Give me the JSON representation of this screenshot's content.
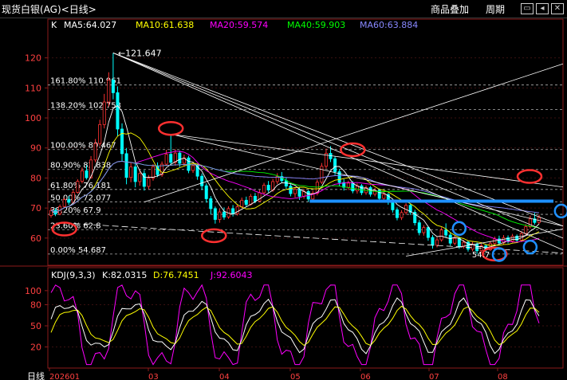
{
  "header": {
    "title": "现货白银(AG)<日线>",
    "overlay_button": "商品叠加",
    "period_button": "周期",
    "icons": [
      "restore-window-icon",
      "arrow-left-icon",
      "close-icon"
    ]
  },
  "main_panel": {
    "k_label": "K",
    "ma_legend": [
      {
        "text": "MA5:64.027",
        "color": "#ffffff"
      },
      {
        "text": "MA10:61.638",
        "color": "#ffff00"
      },
      {
        "text": "MA20:59.574",
        "color": "#ff00ff"
      },
      {
        "text": "MA40:59.903",
        "color": "#00ff00"
      },
      {
        "text": "MA60:63.884",
        "color": "#8888ff"
      }
    ],
    "high_label": "121.647",
    "low_label": "54.7",
    "fib_levels": [
      {
        "label": "161.80%",
        "value": "110.961",
        "price": 110.961
      },
      {
        "label": "138.20%",
        "value": "102.753",
        "price": 102.753
      },
      {
        "label": "100.00%",
        "value": "89.467",
        "price": 89.467
      },
      {
        "label": "80.90%",
        "value": "82.838",
        "price": 82.838
      },
      {
        "label": "61.80%",
        "value": "76.181",
        "price": 76.181
      },
      {
        "label": "50.00%",
        "value": "72.077",
        "price": 72.077
      },
      {
        "label": "38.20%",
        "value": "67.9",
        "price": 67.9
      },
      {
        "label": "23.60%",
        "value": "62.8",
        "price": 62.8
      },
      {
        "label": "0.00%",
        "value": "54.687",
        "price": 54.687
      }
    ],
    "blue_support_price": 72.3
  },
  "kdj_panel": {
    "title": "KDJ(9,3,3)",
    "k_text": "K:82.0315",
    "d_text": "D:76.7451",
    "j_text": "J:92.6043",
    "k_color": "#ffffff",
    "d_color": "#ffff00",
    "j_color": "#ff00ff"
  },
  "xaxis": {
    "label": "日线",
    "ticks": [
      "202601",
      "03",
      "04",
      "05",
      "06",
      "07",
      "08"
    ]
  },
  "chart_data": {
    "type": "candlestick",
    "title": "现货白银(AG)<日线>",
    "price_axis": {
      "ticks": [
        60,
        70,
        80,
        90,
        100,
        110,
        120
      ],
      "range": [
        52,
        126
      ]
    },
    "kdj_axis": {
      "ticks": [
        20,
        50,
        80,
        100
      ],
      "range": [
        -10,
        110
      ]
    },
    "candles": [
      {
        "o": 67.5,
        "c": 69.2,
        "h": 70.1,
        "l": 66.8
      },
      {
        "o": 69.2,
        "c": 68.0,
        "h": 70.0,
        "l": 67.3
      },
      {
        "o": 68.0,
        "c": 70.5,
        "h": 71.2,
        "l": 67.6
      },
      {
        "o": 70.5,
        "c": 72.8,
        "h": 73.5,
        "l": 70.0
      },
      {
        "o": 72.8,
        "c": 71.9,
        "h": 74.0,
        "l": 71.0
      },
      {
        "o": 71.9,
        "c": 75.2,
        "h": 76.0,
        "l": 71.5
      },
      {
        "o": 75.2,
        "c": 78.9,
        "h": 79.6,
        "l": 74.8
      },
      {
        "o": 78.9,
        "c": 82.4,
        "h": 83.5,
        "l": 78.2
      },
      {
        "o": 82.4,
        "c": 80.1,
        "h": 84.2,
        "l": 79.5
      },
      {
        "o": 80.1,
        "c": 86.0,
        "h": 87.3,
        "l": 79.8
      },
      {
        "o": 86.0,
        "c": 91.5,
        "h": 93.0,
        "l": 85.2
      },
      {
        "o": 91.5,
        "c": 97.8,
        "h": 99.4,
        "l": 90.6
      },
      {
        "o": 97.8,
        "c": 105.3,
        "h": 108.0,
        "l": 96.5
      },
      {
        "o": 105.3,
        "c": 112.6,
        "h": 115.2,
        "l": 103.8
      },
      {
        "o": 112.6,
        "c": 108.4,
        "h": 121.6,
        "l": 106.2
      },
      {
        "o": 108.4,
        "c": 96.3,
        "h": 110.5,
        "l": 94.0
      },
      {
        "o": 96.3,
        "c": 88.1,
        "h": 98.2,
        "l": 85.4
      },
      {
        "o": 88.1,
        "c": 80.2,
        "h": 90.0,
        "l": 77.9
      },
      {
        "o": 80.2,
        "c": 83.7,
        "h": 85.1,
        "l": 78.6
      },
      {
        "o": 83.7,
        "c": 78.8,
        "h": 85.0,
        "l": 76.9
      },
      {
        "o": 78.8,
        "c": 81.5,
        "h": 82.9,
        "l": 77.4
      },
      {
        "o": 81.5,
        "c": 77.2,
        "h": 82.6,
        "l": 75.8
      },
      {
        "o": 77.2,
        "c": 79.9,
        "h": 81.0,
        "l": 76.3
      },
      {
        "o": 79.9,
        "c": 83.8,
        "h": 84.6,
        "l": 79.1
      },
      {
        "o": 83.8,
        "c": 81.1,
        "h": 85.2,
        "l": 80.3
      },
      {
        "o": 81.1,
        "c": 84.6,
        "h": 85.5,
        "l": 80.4
      },
      {
        "o": 84.6,
        "c": 87.9,
        "h": 89.4,
        "l": 84.0
      },
      {
        "o": 87.9,
        "c": 85.2,
        "h": 94.6,
        "l": 84.5
      },
      {
        "o": 85.2,
        "c": 88.3,
        "h": 89.6,
        "l": 84.1
      },
      {
        "o": 88.3,
        "c": 84.9,
        "h": 89.1,
        "l": 83.7
      },
      {
        "o": 84.9,
        "c": 86.7,
        "h": 87.8,
        "l": 83.9
      },
      {
        "o": 86.7,
        "c": 82.5,
        "h": 87.4,
        "l": 81.6
      },
      {
        "o": 82.5,
        "c": 84.1,
        "h": 85.0,
        "l": 81.7
      },
      {
        "o": 84.1,
        "c": 80.6,
        "h": 84.8,
        "l": 79.4
      },
      {
        "o": 80.6,
        "c": 77.4,
        "h": 81.5,
        "l": 76.0
      },
      {
        "o": 77.4,
        "c": 73.1,
        "h": 78.2,
        "l": 71.8
      },
      {
        "o": 73.1,
        "c": 69.8,
        "h": 74.0,
        "l": 67.9
      },
      {
        "o": 69.8,
        "c": 66.2,
        "h": 70.5,
        "l": 64.8
      },
      {
        "o": 66.2,
        "c": 68.7,
        "h": 69.9,
        "l": 65.1
      },
      {
        "o": 68.7,
        "c": 67.0,
        "h": 70.2,
        "l": 66.1
      },
      {
        "o": 67.0,
        "c": 69.8,
        "h": 70.6,
        "l": 66.4
      },
      {
        "o": 69.8,
        "c": 68.1,
        "h": 71.0,
        "l": 67.2
      },
      {
        "o": 68.1,
        "c": 70.4,
        "h": 71.3,
        "l": 67.5
      },
      {
        "o": 70.4,
        "c": 72.6,
        "h": 73.5,
        "l": 69.9
      },
      {
        "o": 72.6,
        "c": 71.2,
        "h": 73.8,
        "l": 70.5
      },
      {
        "o": 71.2,
        "c": 73.9,
        "h": 74.7,
        "l": 70.8
      },
      {
        "o": 73.9,
        "c": 72.3,
        "h": 75.0,
        "l": 71.6
      },
      {
        "o": 72.3,
        "c": 75.1,
        "h": 76.0,
        "l": 71.9
      },
      {
        "o": 75.1,
        "c": 77.6,
        "h": 78.4,
        "l": 74.5
      },
      {
        "o": 77.6,
        "c": 76.0,
        "h": 79.0,
        "l": 75.2
      },
      {
        "o": 76.0,
        "c": 78.8,
        "h": 79.7,
        "l": 75.4
      },
      {
        "o": 78.8,
        "c": 80.5,
        "h": 81.6,
        "l": 78.0
      },
      {
        "o": 80.5,
        "c": 79.1,
        "h": 82.0,
        "l": 78.3
      },
      {
        "o": 79.1,
        "c": 77.3,
        "h": 80.2,
        "l": 76.4
      },
      {
        "o": 77.3,
        "c": 74.8,
        "h": 78.1,
        "l": 73.9
      },
      {
        "o": 74.8,
        "c": 76.2,
        "h": 77.0,
        "l": 73.5
      },
      {
        "o": 76.2,
        "c": 73.9,
        "h": 76.9,
        "l": 72.7
      },
      {
        "o": 73.9,
        "c": 75.5,
        "h": 76.3,
        "l": 73.1
      },
      {
        "o": 75.5,
        "c": 73.0,
        "h": 76.0,
        "l": 72.1
      },
      {
        "o": 73.0,
        "c": 74.9,
        "h": 75.8,
        "l": 72.4
      },
      {
        "o": 74.9,
        "c": 78.6,
        "h": 79.5,
        "l": 74.2
      },
      {
        "o": 78.6,
        "c": 83.9,
        "h": 85.0,
        "l": 78.0
      },
      {
        "o": 83.9,
        "c": 88.2,
        "h": 89.8,
        "l": 83.1
      },
      {
        "o": 88.2,
        "c": 86.4,
        "h": 90.6,
        "l": 85.3
      },
      {
        "o": 86.4,
        "c": 82.1,
        "h": 87.2,
        "l": 81.0
      },
      {
        "o": 82.1,
        "c": 78.5,
        "h": 83.0,
        "l": 77.2
      },
      {
        "o": 78.5,
        "c": 76.9,
        "h": 79.6,
        "l": 75.8
      },
      {
        "o": 76.9,
        "c": 78.3,
        "h": 79.1,
        "l": 76.0
      },
      {
        "o": 78.3,
        "c": 75.7,
        "h": 79.0,
        "l": 74.9
      },
      {
        "o": 75.7,
        "c": 77.4,
        "h": 78.2,
        "l": 74.8
      },
      {
        "o": 77.4,
        "c": 75.1,
        "h": 78.0,
        "l": 74.3
      },
      {
        "o": 75.1,
        "c": 76.8,
        "h": 77.5,
        "l": 74.4
      },
      {
        "o": 76.8,
        "c": 74.6,
        "h": 77.4,
        "l": 73.8
      },
      {
        "o": 74.6,
        "c": 75.9,
        "h": 76.7,
        "l": 73.9
      },
      {
        "o": 75.9,
        "c": 73.2,
        "h": 76.5,
        "l": 72.4
      },
      {
        "o": 73.2,
        "c": 74.5,
        "h": 75.3,
        "l": 72.5
      },
      {
        "o": 74.5,
        "c": 72.0,
        "h": 75.0,
        "l": 71.1
      },
      {
        "o": 72.0,
        "c": 69.4,
        "h": 72.8,
        "l": 68.5
      },
      {
        "o": 69.4,
        "c": 66.8,
        "h": 70.2,
        "l": 65.9
      },
      {
        "o": 66.8,
        "c": 68.5,
        "h": 69.3,
        "l": 66.0
      },
      {
        "o": 68.5,
        "c": 70.9,
        "h": 71.6,
        "l": 67.8
      },
      {
        "o": 70.9,
        "c": 68.6,
        "h": 71.5,
        "l": 67.7
      },
      {
        "o": 68.6,
        "c": 65.1,
        "h": 69.4,
        "l": 64.2
      },
      {
        "o": 65.1,
        "c": 61.8,
        "h": 66.0,
        "l": 60.9
      },
      {
        "o": 61.8,
        "c": 63.5,
        "h": 64.3,
        "l": 60.8
      },
      {
        "o": 63.5,
        "c": 60.2,
        "h": 64.0,
        "l": 59.1
      },
      {
        "o": 60.2,
        "c": 57.6,
        "h": 61.0,
        "l": 56.5
      },
      {
        "o": 57.6,
        "c": 59.4,
        "h": 60.3,
        "l": 56.9
      },
      {
        "o": 59.4,
        "c": 62.7,
        "h": 63.6,
        "l": 58.8
      },
      {
        "o": 62.7,
        "c": 61.0,
        "h": 64.9,
        "l": 60.1
      },
      {
        "o": 61.0,
        "c": 58.3,
        "h": 61.8,
        "l": 57.4
      },
      {
        "o": 58.3,
        "c": 59.9,
        "h": 60.7,
        "l": 57.6
      },
      {
        "o": 59.9,
        "c": 57.2,
        "h": 60.5,
        "l": 56.4
      },
      {
        "o": 57.2,
        "c": 58.6,
        "h": 59.4,
        "l": 56.5
      },
      {
        "o": 58.6,
        "c": 56.3,
        "h": 59.1,
        "l": 55.5
      },
      {
        "o": 56.3,
        "c": 57.9,
        "h": 58.7,
        "l": 55.6
      },
      {
        "o": 57.9,
        "c": 55.8,
        "h": 58.5,
        "l": 54.7
      },
      {
        "o": 55.8,
        "c": 57.4,
        "h": 58.2,
        "l": 55.1
      },
      {
        "o": 57.4,
        "c": 56.1,
        "h": 58.0,
        "l": 55.3
      },
      {
        "o": 56.1,
        "c": 58.2,
        "h": 59.0,
        "l": 55.7
      },
      {
        "o": 58.2,
        "c": 59.7,
        "h": 60.5,
        "l": 57.6
      },
      {
        "o": 59.7,
        "c": 58.4,
        "h": 60.8,
        "l": 57.8
      },
      {
        "o": 58.4,
        "c": 60.1,
        "h": 61.0,
        "l": 57.9
      },
      {
        "o": 60.1,
        "c": 59.0,
        "h": 60.9,
        "l": 58.2
      },
      {
        "o": 59.0,
        "c": 60.6,
        "h": 61.4,
        "l": 58.5
      },
      {
        "o": 60.6,
        "c": 59.3,
        "h": 61.2,
        "l": 58.7
      },
      {
        "o": 59.3,
        "c": 61.5,
        "h": 62.3,
        "l": 58.9
      },
      {
        "o": 61.5,
        "c": 63.8,
        "h": 64.6,
        "l": 61.0
      },
      {
        "o": 63.8,
        "c": 66.4,
        "h": 67.5,
        "l": 63.2
      },
      {
        "o": 66.4,
        "c": 65.2,
        "h": 68.4,
        "l": 64.5
      },
      {
        "o": 65.2,
        "c": 66.9,
        "h": 67.8,
        "l": 64.6
      }
    ]
  }
}
